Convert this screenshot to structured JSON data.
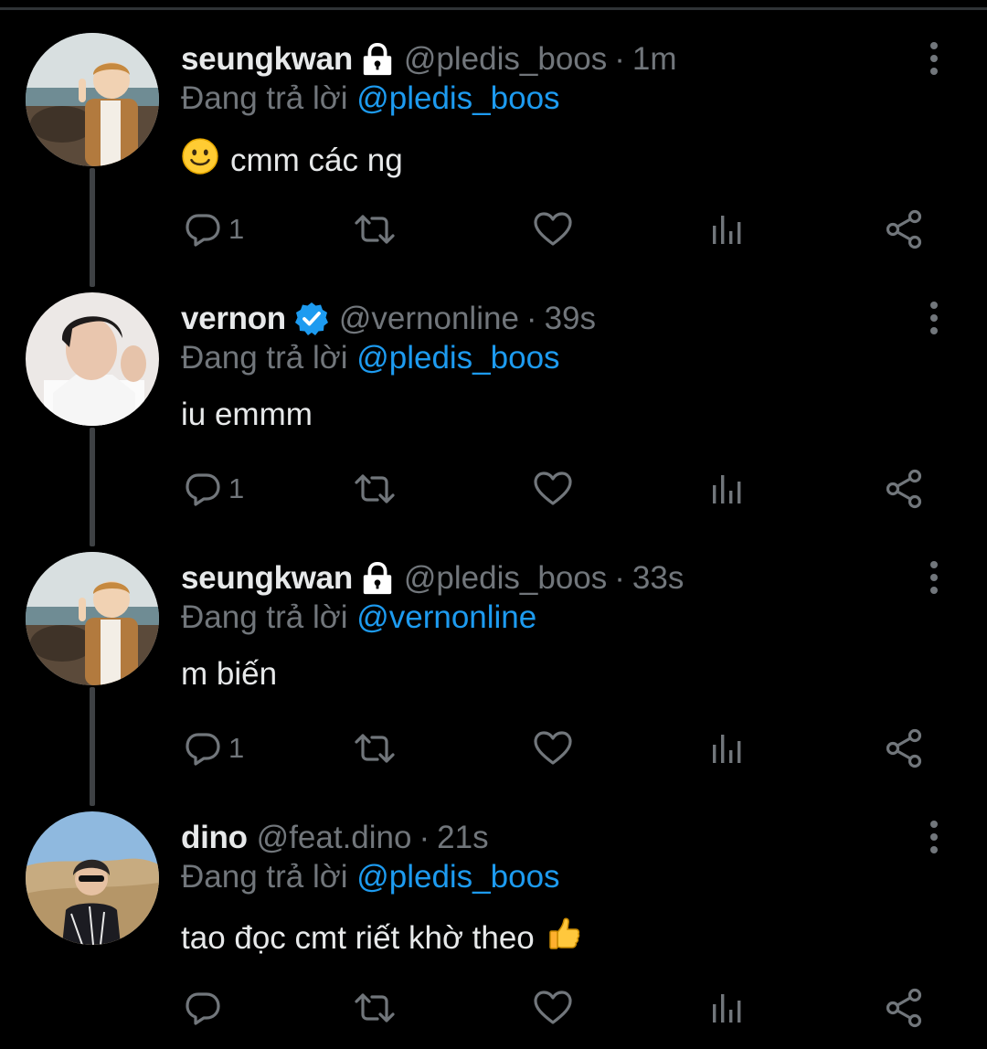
{
  "colors": {
    "background": "#000000",
    "text_primary": "#e7e9ea",
    "text_secondary": "#71767b",
    "accent": "#1d9bf0",
    "thread_line": "#3e4144"
  },
  "tweets": [
    {
      "name": "seungkwan",
      "badge_icon": "lock-icon",
      "handle": "@pledis_boos",
      "separator": "·",
      "time": "1m",
      "reply_prefix": "Đang trả lời",
      "reply_to": "@pledis_boos",
      "leading_emoji": "slightly-smiling-face-emoji",
      "text": "cmm các ng",
      "reply_count": "1"
    },
    {
      "name": "vernon",
      "badge_icon": "verified-badge-icon",
      "handle": "@vernonline",
      "separator": "·",
      "time": "39s",
      "reply_prefix": "Đang trả lời",
      "reply_to": "@pledis_boos",
      "text": "iu emmm",
      "reply_count": "1"
    },
    {
      "name": "seungkwan",
      "badge_icon": "lock-icon",
      "handle": "@pledis_boos",
      "separator": "·",
      "time": "33s",
      "reply_prefix": "Đang trả lời",
      "reply_to": "@vernonline",
      "text": "m biến",
      "reply_count": "1"
    },
    {
      "name": "dino",
      "handle": "@feat.dino",
      "separator": "·",
      "time": "21s",
      "reply_prefix": "Đang trả lời",
      "reply_to": "@pledis_boos",
      "text": "tao đọc cmt riết khờ theo",
      "trailing_emoji": "thumbs-up-emoji",
      "reply_count": ""
    }
  ],
  "action_icons": [
    "reply-icon",
    "retweet-icon",
    "like-icon",
    "views-icon",
    "share-icon"
  ]
}
